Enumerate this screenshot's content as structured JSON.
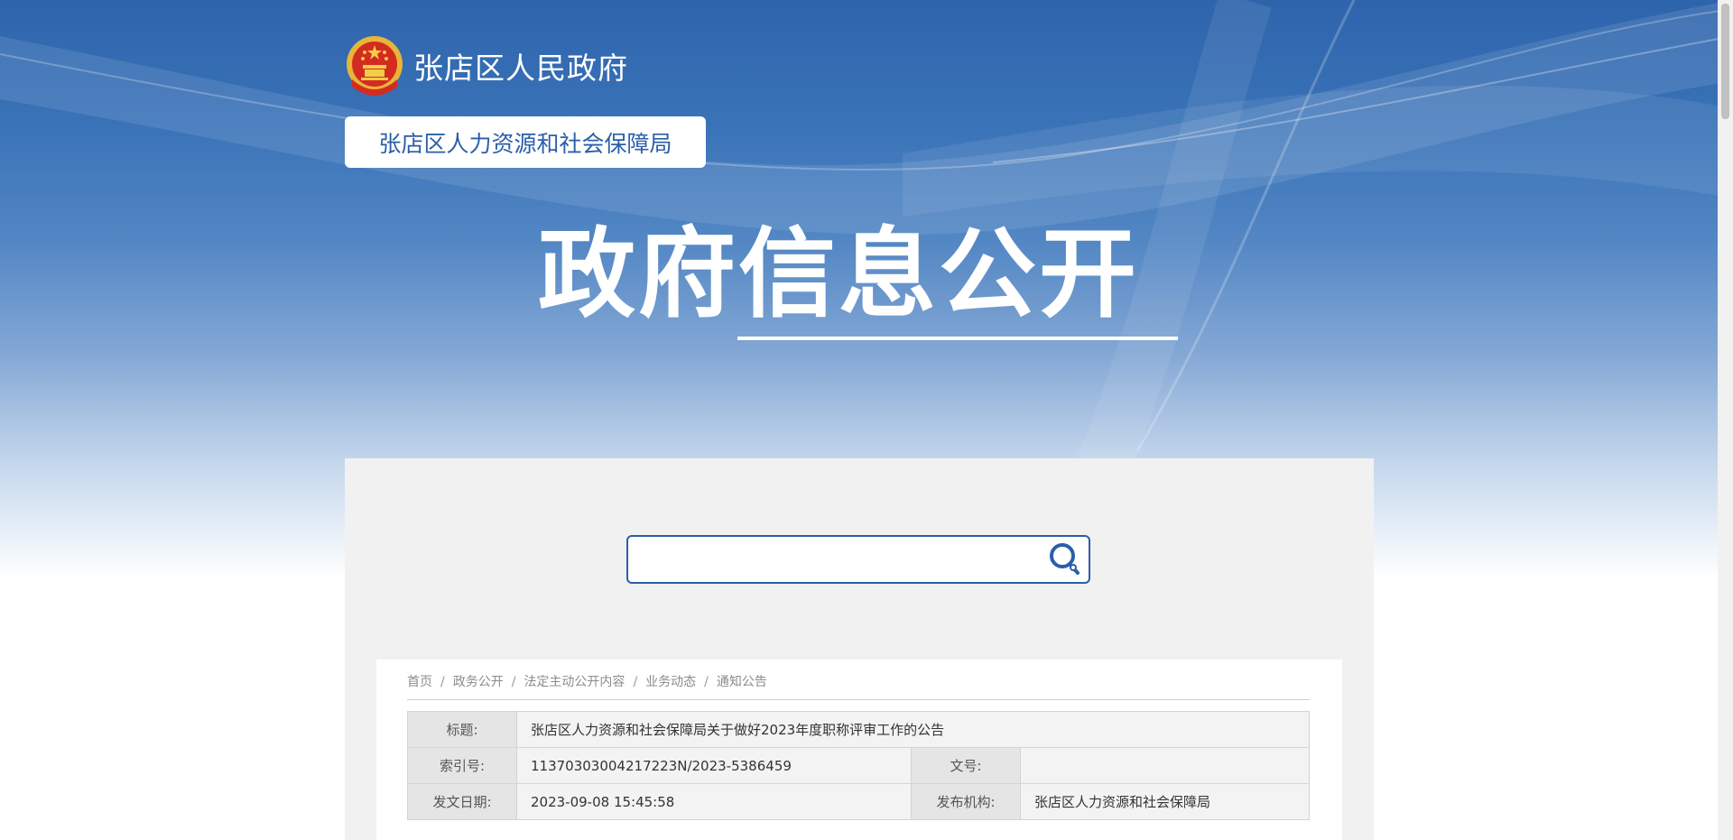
{
  "header": {
    "site_name": "张店区人民政府",
    "department": "张店区人力资源和社会保障局",
    "section_title": "政府信息公开",
    "emblem": "national-emblem-icon"
  },
  "search": {
    "value": "",
    "placeholder": "",
    "icon": "search-icon"
  },
  "breadcrumb": {
    "items": [
      "首页",
      "政务公开",
      "法定主动公开内容",
      "业务动态",
      "通知公告"
    ],
    "separator": "/"
  },
  "info": {
    "title_label": "标题:",
    "title_value": "张店区人力资源和社会保障局关于做好2023年度职称评审工作的公告",
    "index_label": "索引号:",
    "index_value": "11370303004217223N/2023-5386459",
    "docno_label": "文号:",
    "docno_value": "",
    "date_label": "发文日期:",
    "date_value": "2023-09-08 15:45:58",
    "org_label": "发布机构:",
    "org_value": "张店区人力资源和社会保障局"
  },
  "colors": {
    "brand_blue": "#2b5ea8",
    "panel_gray": "#f1f1f1",
    "label_gray": "#e5e5e5"
  }
}
